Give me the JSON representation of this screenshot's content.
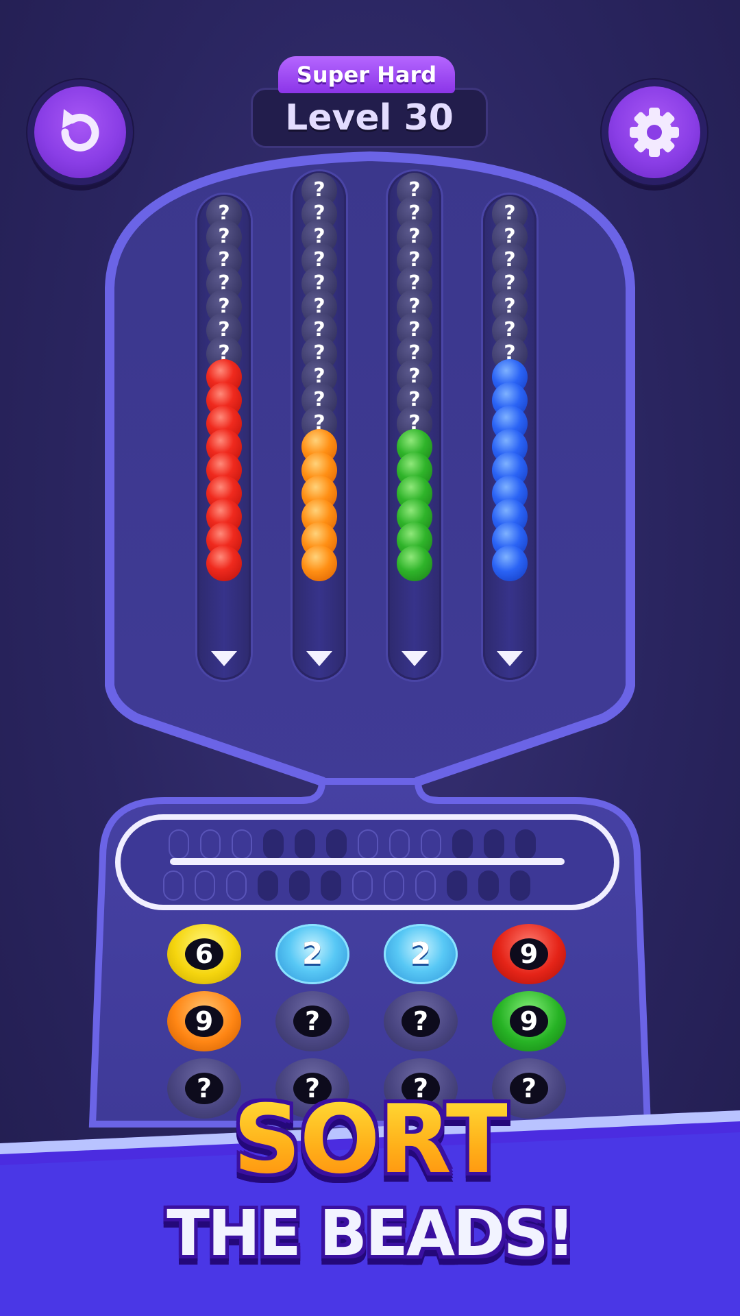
{
  "header": {
    "difficulty": "Super Hard",
    "level": "Level 30"
  },
  "buttons": {
    "restart_icon": "restart-arrow-icon",
    "settings_icon": "gear-icon"
  },
  "colors": {
    "background": "#2a2560",
    "machine": "#3f3a92",
    "machine_border": "#6a63e0",
    "accent": "#8a3ee6",
    "title_gold": "#ffb11a"
  },
  "columns": [
    {
      "hidden_count": 7,
      "bead_color": "red",
      "bead_count": 9
    },
    {
      "hidden_count": 11,
      "bead_color": "orange",
      "bead_count": 6
    },
    {
      "hidden_count": 11,
      "bead_color": "green",
      "bead_count": 6
    },
    {
      "hidden_count": 7,
      "bead_color": "blue",
      "bead_count": 9
    }
  ],
  "hidden_mark": "?",
  "tokens": [
    [
      {
        "color": "yellow",
        "label": "6"
      },
      {
        "color": "ice",
        "label": "2"
      },
      {
        "color": "ice",
        "label": "2"
      },
      {
        "color": "red",
        "label": "9"
      }
    ],
    [
      {
        "color": "orange",
        "label": "9"
      },
      {
        "color": "grey",
        "label": "?"
      },
      {
        "color": "grey",
        "label": "?"
      },
      {
        "color": "green",
        "label": "9"
      }
    ],
    [
      {
        "color": "grey",
        "label": "?"
      },
      {
        "color": "grey",
        "label": "?"
      },
      {
        "color": "grey",
        "label": "?"
      },
      {
        "color": "grey",
        "label": "?"
      }
    ]
  ],
  "banner": {
    "title": "SORT",
    "subtitle": "THE BEADS!"
  }
}
